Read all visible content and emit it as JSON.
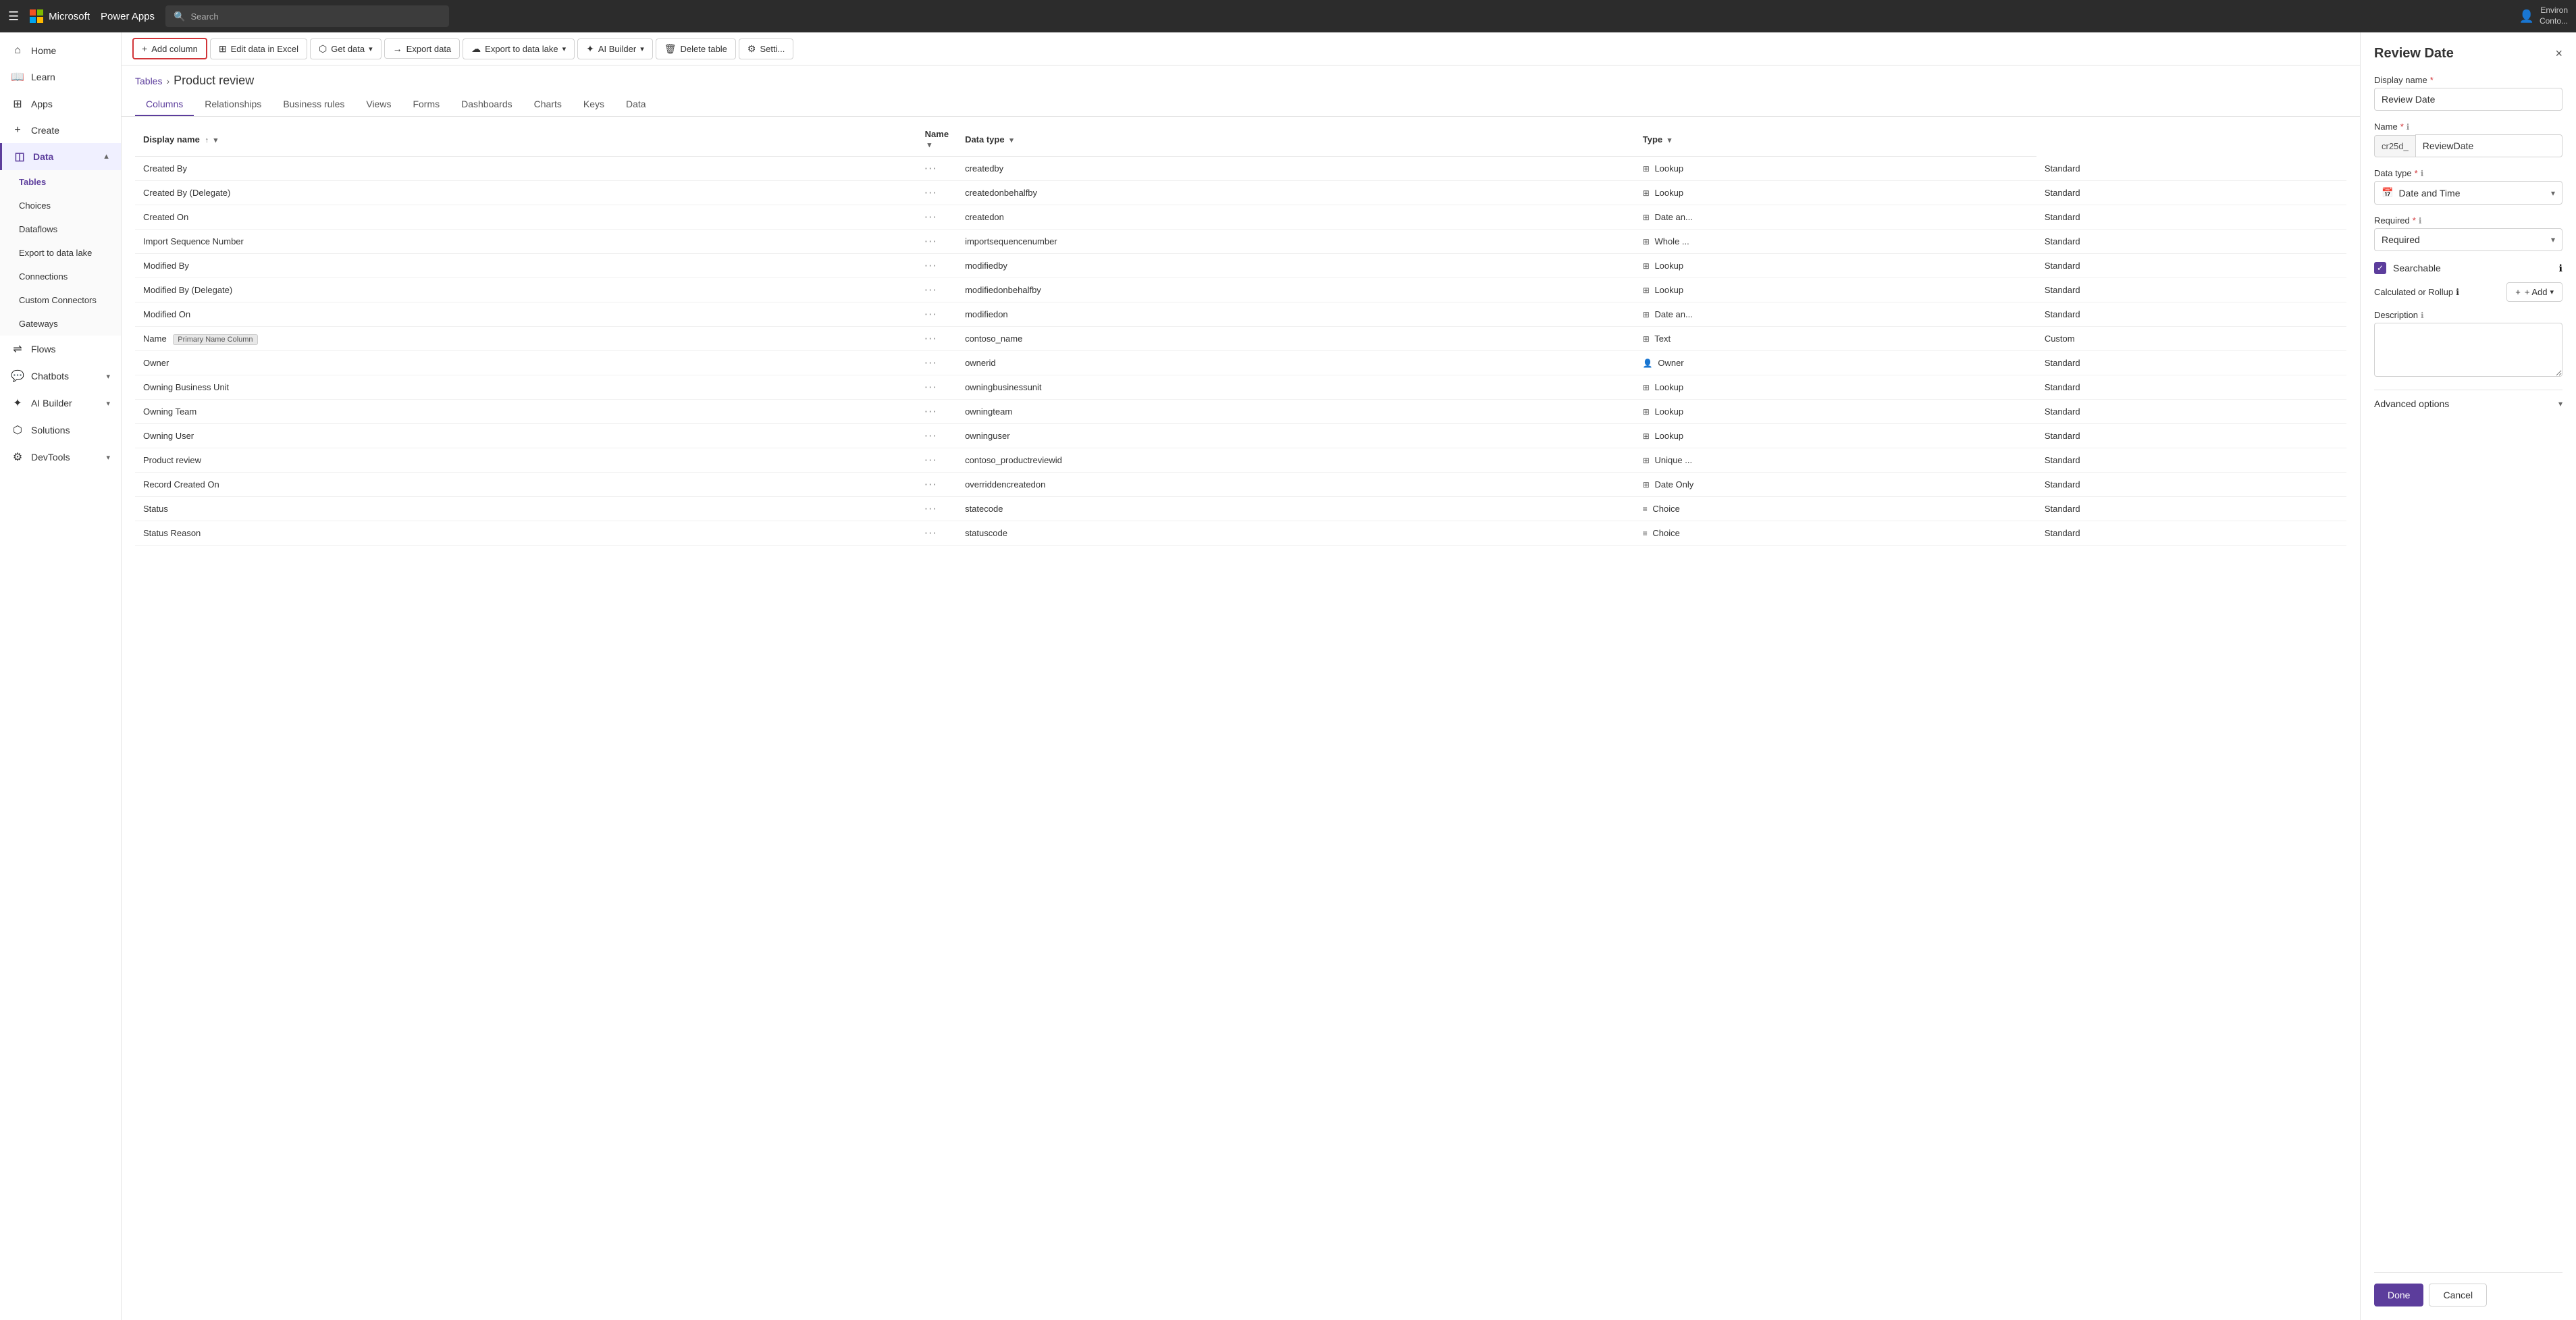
{
  "topbar": {
    "grid_label": "grid",
    "logo_alt": "Microsoft",
    "app_name": "Power Apps",
    "search_placeholder": "Search",
    "env_line1": "Environ",
    "env_line2": "Conto..."
  },
  "sidebar": {
    "hamburger": "menu",
    "items": [
      {
        "id": "home",
        "label": "Home",
        "icon": "⌂",
        "active": false
      },
      {
        "id": "learn",
        "label": "Learn",
        "icon": "📖",
        "active": false
      },
      {
        "id": "apps",
        "label": "Apps",
        "icon": "⊞",
        "active": false
      },
      {
        "id": "create",
        "label": "Create",
        "icon": "+",
        "active": false
      },
      {
        "id": "data",
        "label": "Data",
        "icon": "◫",
        "active": true,
        "expandable": true
      },
      {
        "id": "tables",
        "label": "Tables",
        "active": true,
        "sub": true
      },
      {
        "id": "choices",
        "label": "Choices",
        "active": false,
        "sub": true
      },
      {
        "id": "dataflows",
        "label": "Dataflows",
        "active": false,
        "sub": true
      },
      {
        "id": "export",
        "label": "Export to data lake",
        "active": false,
        "sub": true
      },
      {
        "id": "connections",
        "label": "Connections",
        "active": false,
        "sub": true
      },
      {
        "id": "custom-connectors",
        "label": "Custom Connectors",
        "active": false,
        "sub": true
      },
      {
        "id": "gateways",
        "label": "Gateways",
        "active": false,
        "sub": true
      },
      {
        "id": "flows",
        "label": "Flows",
        "icon": "⇌",
        "active": false
      },
      {
        "id": "chatbots",
        "label": "Chatbots",
        "icon": "💬",
        "active": false,
        "expandable": true
      },
      {
        "id": "ai-builder",
        "label": "AI Builder",
        "icon": "✦",
        "active": false,
        "expandable": true
      },
      {
        "id": "solutions",
        "label": "Solutions",
        "icon": "⬡",
        "active": false
      },
      {
        "id": "devtools",
        "label": "DevTools",
        "icon": "⚙",
        "active": false,
        "expandable": true
      }
    ]
  },
  "toolbar": {
    "add_column_label": "Add column",
    "edit_excel_label": "Edit data in Excel",
    "get_data_label": "Get data",
    "export_data_label": "Export data",
    "export_lake_label": "Export to data lake",
    "ai_builder_label": "AI Builder",
    "delete_table_label": "Delete table",
    "settings_label": "Setti..."
  },
  "breadcrumb": {
    "tables_label": "Tables",
    "separator": "›",
    "current": "Product review"
  },
  "tabs": [
    {
      "id": "columns",
      "label": "Columns",
      "active": true
    },
    {
      "id": "relationships",
      "label": "Relationships",
      "active": false
    },
    {
      "id": "business-rules",
      "label": "Business rules",
      "active": false
    },
    {
      "id": "views",
      "label": "Views",
      "active": false
    },
    {
      "id": "forms",
      "label": "Forms",
      "active": false
    },
    {
      "id": "dashboards",
      "label": "Dashboards",
      "active": false
    },
    {
      "id": "charts",
      "label": "Charts",
      "active": false
    },
    {
      "id": "keys",
      "label": "Keys",
      "active": false
    },
    {
      "id": "data",
      "label": "Data",
      "active": false
    }
  ],
  "table": {
    "headers": [
      {
        "id": "display-name",
        "label": "Display name",
        "sortable": true
      },
      {
        "id": "name",
        "label": "Name",
        "sortable": true
      },
      {
        "id": "data-type",
        "label": "Data type",
        "sortable": true
      },
      {
        "id": "type",
        "label": "Type",
        "sortable": true
      }
    ],
    "rows": [
      {
        "display_name": "Created By",
        "dots": "···",
        "name": "createdby",
        "data_type": "Lookup",
        "data_type_icon": "⊞",
        "type": "Standard"
      },
      {
        "display_name": "Created By (Delegate)",
        "dots": "···",
        "name": "createdonbehalfby",
        "data_type": "Lookup",
        "data_type_icon": "⊞",
        "type": "Standard"
      },
      {
        "display_name": "Created On",
        "dots": "···",
        "name": "createdon",
        "data_type": "Date an...",
        "data_type_icon": "⊞",
        "type": "Standard"
      },
      {
        "display_name": "Import Sequence Number",
        "dots": "···",
        "name": "importsequencenumber",
        "data_type": "Whole ...",
        "data_type_icon": "⊞",
        "type": "Standard"
      },
      {
        "display_name": "Modified By",
        "dots": "···",
        "name": "modifiedby",
        "data_type": "Lookup",
        "data_type_icon": "⊞",
        "type": "Standard"
      },
      {
        "display_name": "Modified By (Delegate)",
        "dots": "···",
        "name": "modifiedonbehalfby",
        "data_type": "Lookup",
        "data_type_icon": "⊞",
        "type": "Standard"
      },
      {
        "display_name": "Modified On",
        "dots": "···",
        "name": "modifiedon",
        "data_type": "Date an...",
        "data_type_icon": "⊞",
        "type": "Standard"
      },
      {
        "display_name": "Name",
        "dots": "···",
        "name": "contoso_name",
        "badge": "Primary Name Column",
        "data_type": "Text",
        "data_type_icon": "⊞",
        "type": "Custom"
      },
      {
        "display_name": "Owner",
        "dots": "···",
        "name": "ownerid",
        "data_type": "Owner",
        "data_type_icon": "👤",
        "type": "Standard"
      },
      {
        "display_name": "Owning Business Unit",
        "dots": "···",
        "name": "owningbusinessunit",
        "data_type": "Lookup",
        "data_type_icon": "⊞",
        "type": "Standard"
      },
      {
        "display_name": "Owning Team",
        "dots": "···",
        "name": "owningteam",
        "data_type": "Lookup",
        "data_type_icon": "⊞",
        "type": "Standard"
      },
      {
        "display_name": "Owning User",
        "dots": "···",
        "name": "owninguser",
        "data_type": "Lookup",
        "data_type_icon": "⊞",
        "type": "Standard"
      },
      {
        "display_name": "Product review",
        "dots": "···",
        "name": "contoso_productreviewid",
        "data_type": "Unique ...",
        "data_type_icon": "⊞",
        "type": "Standard"
      },
      {
        "display_name": "Record Created On",
        "dots": "···",
        "name": "overriddencreatedon",
        "data_type": "Date Only",
        "data_type_icon": "⊞",
        "type": "Standard"
      },
      {
        "display_name": "Status",
        "dots": "···",
        "name": "statecode",
        "data_type": "Choice",
        "data_type_icon": "≡",
        "type": "Standard"
      },
      {
        "display_name": "Status Reason",
        "dots": "···",
        "name": "statuscode",
        "data_type": "Choice",
        "data_type_icon": "≡",
        "type": "Standard"
      }
    ]
  },
  "right_panel": {
    "title": "Review Date",
    "close_label": "×",
    "display_name_label": "Display name",
    "display_name_required": "*",
    "display_name_value": "Review Date",
    "name_label": "Name",
    "name_required": "*",
    "name_prefix": "cr25d_",
    "name_value": "ReviewDate",
    "data_type_label": "Data type",
    "data_type_required": "*",
    "data_type_icon": "📅",
    "data_type_value": "Date and Time",
    "required_label": "Required",
    "required_req": "*",
    "required_value": "Required",
    "searchable_label": "Searchable",
    "calc_label": "Calculated or Rollup",
    "add_label": "+ Add",
    "description_label": "Description",
    "description_placeholder": "",
    "advanced_label": "Advanced options",
    "done_label": "Done",
    "cancel_label": "Cancel",
    "info_icon": "ℹ"
  },
  "colors": {
    "accent": "#5c3d9c",
    "danger": "#d13438",
    "border": "#e5e5e5",
    "topbar_bg": "#2c2c2c"
  }
}
